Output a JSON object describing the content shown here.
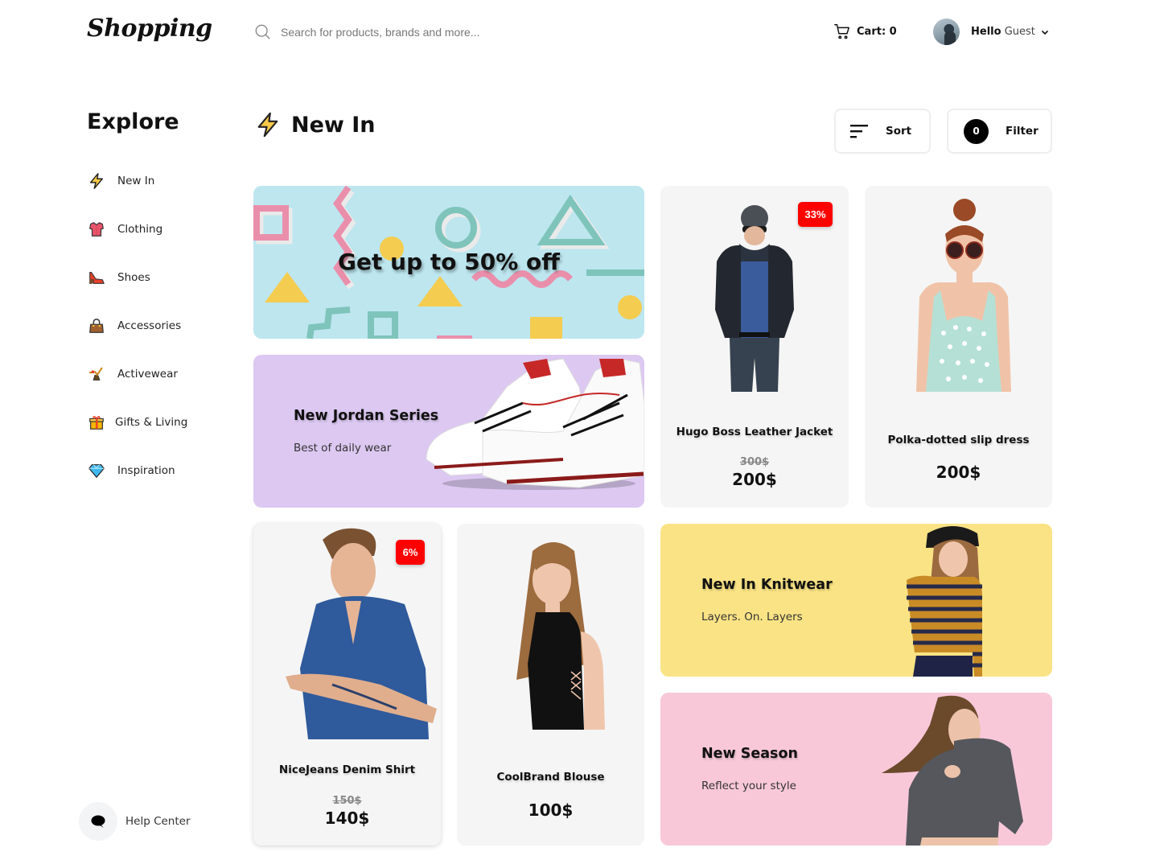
{
  "header": {
    "logo": "Shopping",
    "search_placeholder": "Search for products, brands and more...",
    "cart_label": "Cart: 0",
    "greeting": "Hello",
    "user_name": "Guest"
  },
  "sidebar": {
    "title": "Explore",
    "items": [
      {
        "label": "New In",
        "icon": "lightning-icon"
      },
      {
        "label": "Clothing",
        "icon": "shirt-icon"
      },
      {
        "label": "Shoes",
        "icon": "high-heel-icon"
      },
      {
        "label": "Accessories",
        "icon": "handbag-icon"
      },
      {
        "label": "Activewear",
        "icon": "yoga-pose-icon"
      },
      {
        "label": "Gifts & Living",
        "icon": "gift-icon"
      },
      {
        "label": "Inspiration",
        "icon": "diamond-icon"
      }
    ],
    "help_label": "Help Center"
  },
  "main": {
    "title": "New In",
    "sort_label": "Sort",
    "filter_label": "Filter",
    "filter_count": "0"
  },
  "banners": {
    "sale": {
      "title": "Get up to 50% off",
      "bg": "#bde6ef"
    },
    "jordan": {
      "title": "New Jordan Series",
      "subtitle": "Best of daily wear",
      "bg": "#dcc8f1"
    },
    "knitwear": {
      "title": "New In Knitwear",
      "subtitle": "Layers. On. Layers",
      "bg": "#f9e385"
    },
    "season": {
      "title": "New Season",
      "subtitle": "Reflect your style",
      "bg": "#f8c8d9"
    }
  },
  "products": [
    {
      "name": "Hugo Boss Leather Jacket",
      "old_price": "300$",
      "price": "200$",
      "discount": "33%"
    },
    {
      "name": "Polka-dotted slip dress",
      "price": "200$"
    },
    {
      "name": "NiceJeans Denim Shirt",
      "old_price": "150$",
      "price": "140$",
      "discount": "6%"
    },
    {
      "name": "CoolBrand Blouse",
      "price": "100$"
    }
  ],
  "colors": {
    "discount_badge": "#ff0000",
    "card_bg": "#f5f5f5",
    "accent_yellow": "#f7c948"
  }
}
